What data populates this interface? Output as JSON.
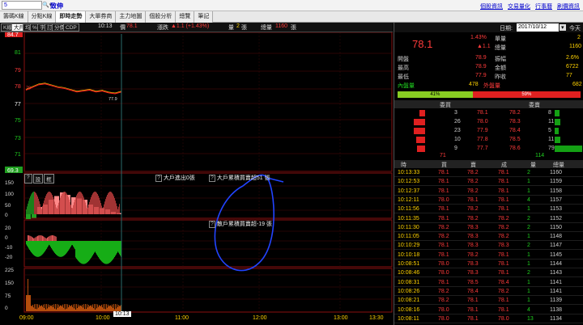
{
  "topbar": {
    "symbol_value": "5",
    "stock_name": "致伸",
    "links": [
      "個股資訊",
      "交易量化",
      "行事曆",
      "刷價資訊"
    ]
  },
  "tabs": [
    "籌碼K線",
    "分點K線",
    "即時走勢",
    "大單券商",
    "主力地圖",
    "個股分析",
    "總覽",
    "筆記"
  ],
  "active_tab": 2,
  "inforow": {
    "modes": [
      "K線",
      "大戶",
      "均",
      "%",
      "字",
      "訂",
      "分價",
      "CDP"
    ],
    "active_mode": 1,
    "time": "10:13",
    "price_label": "價",
    "price": "78.1",
    "change_label": "漲跌",
    "change": "▲1.1 (+1.43%)",
    "vol_label": "量",
    "vol": "2",
    "vol_unit": "張",
    "total_label": "總量",
    "total": "1160",
    "total_unit": "張"
  },
  "chart": {
    "y_labels": [
      {
        "text": "84.7",
        "style": "badge-red"
      },
      {
        "text": "81",
        "style": "green"
      },
      {
        "text": "79",
        "style": "red"
      },
      {
        "text": "78",
        "style": "red"
      },
      {
        "text": "77",
        "style": "white"
      },
      {
        "text": "75",
        "style": "green"
      },
      {
        "text": "73",
        "style": "green"
      },
      {
        "text": "71",
        "style": "green"
      },
      {
        "text": "69.3",
        "style": "badge-green"
      }
    ],
    "open_marker": "79",
    "last_marker": "77.9",
    "ind1_buttons": [
      "?",
      "設",
      "框"
    ],
    "ind1_label": "大戶進出0張",
    "ind1_label2": "大戶累積買賣超51 張",
    "ind1_y": [
      "150",
      "100",
      "50",
      "0"
    ],
    "ind2_label": "散戶累積買賣超-19 張",
    "ind2_y": [
      "20",
      "0",
      "-10",
      "-20"
    ],
    "ind3_y": [
      "225",
      "150",
      "75",
      "0"
    ],
    "x_labels": [
      "09:00",
      "10:00",
      "11:00",
      "12:00",
      "13:00",
      "13:30"
    ],
    "cursor_time": "10:13"
  },
  "chart_data": [
    {
      "type": "line",
      "ylim": [
        69.3,
        84.7
      ],
      "x": [
        "09:00",
        "09:05",
        "09:10",
        "09:15",
        "09:20",
        "09:25",
        "09:30",
        "09:35",
        "09:40",
        "09:45",
        "09:50",
        "09:55",
        "10:00",
        "10:05",
        "10:10",
        "10:13"
      ],
      "series": [
        {
          "values": [
            78.3,
            78.6,
            78.9,
            79.0,
            78.8,
            78.6,
            78.5,
            78.3,
            78.1,
            78.2,
            78.3,
            78.1,
            78.2,
            78.0,
            77.9,
            78.1
          ]
        }
      ]
    },
    {
      "type": "bar",
      "ylim": [
        -25,
        150
      ],
      "series": [
        {
          "values": [
            -20,
            -15,
            30,
            40,
            60,
            75,
            90,
            80,
            70,
            65,
            60,
            40,
            30,
            25,
            20,
            10,
            5
          ]
        }
      ]
    }
  ],
  "quote": {
    "date_label": "日期:",
    "date": "2017/10/12",
    "today_btn": "今天",
    "price": "78.1",
    "pct": "1.43%",
    "change": "▲1.1",
    "rows": [
      {
        "l": "單量",
        "v": "2"
      },
      {
        "l": "總量",
        "v": "1160"
      }
    ],
    "stats": [
      {
        "l1": "開盤",
        "v1": "78.9",
        "l2": "振幅",
        "v2": "2.6%"
      },
      {
        "l1": "最高",
        "v1": "78.9",
        "l2": "金額",
        "v2": "6722"
      },
      {
        "l1": "最低",
        "v1": "77.9",
        "l2": "昨收",
        "v2": "77"
      }
    ],
    "inner_label": "內盤量",
    "inner": "478",
    "outer_label": "外盤量",
    "outer": "682",
    "bar_left_pct": "41%",
    "bar_right_pct": "59%",
    "buy_head": "委買",
    "sell_head": "委賣",
    "book": [
      {
        "bq": "3",
        "bp": "78.1",
        "sp": "78.2",
        "sq": "8"
      },
      {
        "bq": "26",
        "bp": "78.0",
        "sp": "78.3",
        "sq": "11"
      },
      {
        "bq": "23",
        "bp": "77.9",
        "sp": "78.4",
        "sq": "5"
      },
      {
        "bq": "10",
        "bp": "77.8",
        "sp": "78.5",
        "sq": "11"
      },
      {
        "bq": "9",
        "bp": "77.7",
        "sp": "78.6",
        "sq": "79"
      }
    ],
    "book_totals": {
      "buy": "71",
      "sell": "114"
    },
    "tick_head": [
      "時",
      "買",
      "賣",
      "成",
      "量",
      "總量"
    ],
    "ticks": [
      [
        "10:13:33",
        "78.1",
        "78.2",
        "78.1",
        "2",
        "1160"
      ],
      [
        "10:12:53",
        "78.1",
        "78.2",
        "78.1",
        "1",
        "1159"
      ],
      [
        "10:12:37",
        "78.1",
        "78.2",
        "78.1",
        "1",
        "1158"
      ],
      [
        "10:12:11",
        "78.0",
        "78.1",
        "78.1",
        "4",
        "1157"
      ],
      [
        "10:11:56",
        "78.1",
        "78.2",
        "78.1",
        "1",
        "1153"
      ],
      [
        "10:11:35",
        "78.1",
        "78.2",
        "78.2",
        "2",
        "1152"
      ],
      [
        "10:11:30",
        "78.2",
        "78.3",
        "78.2",
        "2",
        "1150"
      ],
      [
        "10:11:05",
        "78.2",
        "78.3",
        "78.2",
        "1",
        "1148"
      ],
      [
        "10:10:29",
        "78.1",
        "78.3",
        "78.3",
        "2",
        "1147"
      ],
      [
        "10:10:18",
        "78.1",
        "78.2",
        "78.1",
        "1",
        "1145"
      ],
      [
        "10:08:51",
        "78.0",
        "78.3",
        "78.1",
        "1",
        "1144"
      ],
      [
        "10:08:46",
        "78.0",
        "78.3",
        "78.1",
        "2",
        "1143"
      ],
      [
        "10:08:31",
        "78.1",
        "78.5",
        "78.4",
        "1",
        "1141"
      ],
      [
        "10:08:26",
        "78.2",
        "78.4",
        "78.2",
        "1",
        "1141"
      ],
      [
        "10:08:21",
        "78.2",
        "78.1",
        "78.1",
        "1",
        "1139"
      ],
      [
        "10:08:16",
        "78.0",
        "78.1",
        "78.1",
        "4",
        "1138"
      ],
      [
        "10:08:11",
        "78.0",
        "78.1",
        "78.0",
        "13",
        "1134"
      ]
    ]
  }
}
